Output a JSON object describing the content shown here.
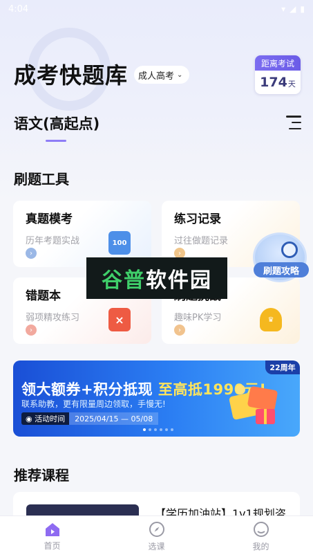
{
  "status_bar": {
    "time": "4:04"
  },
  "header": {
    "app_title": "成考快题库",
    "exam_type": "成人高考",
    "countdown_label": "距离考试",
    "countdown_value": "174",
    "countdown_unit": "天"
  },
  "subject": {
    "name": "语文(高起点)"
  },
  "tools": {
    "section_title": "刷题工具",
    "items": [
      {
        "title": "真题模考",
        "desc": "历年考题实战",
        "icon": "100"
      },
      {
        "title": "练习记录",
        "desc": "过往做题记录"
      },
      {
        "title": "错题本",
        "desc": "弱项精攻练习"
      },
      {
        "title": "刷题挑战",
        "desc": "趣味PK学习"
      }
    ],
    "float_badge": "刷题攻略"
  },
  "watermark": {
    "text_a": "谷普",
    "text_b": "软件园"
  },
  "banner": {
    "headline_a": "领大额券+积分抵现 ",
    "headline_b": "至高抵1990元!",
    "sub": "联系助教，更有限量周边领取，手慢无!",
    "time_label": "活动时间",
    "time_value": "2025/04/15 — 05/08",
    "anniversary": "22周年"
  },
  "courses": {
    "section_title": "推荐课程",
    "items": [
      {
        "title": "【学历加油站】1v1规划咨"
      }
    ]
  },
  "tabbar": {
    "items": [
      {
        "label": "首页"
      },
      {
        "label": "选课"
      },
      {
        "label": "我的"
      }
    ]
  },
  "colors": {
    "accent": "#8e7cf6",
    "home_icon": "#8e6bf1"
  }
}
